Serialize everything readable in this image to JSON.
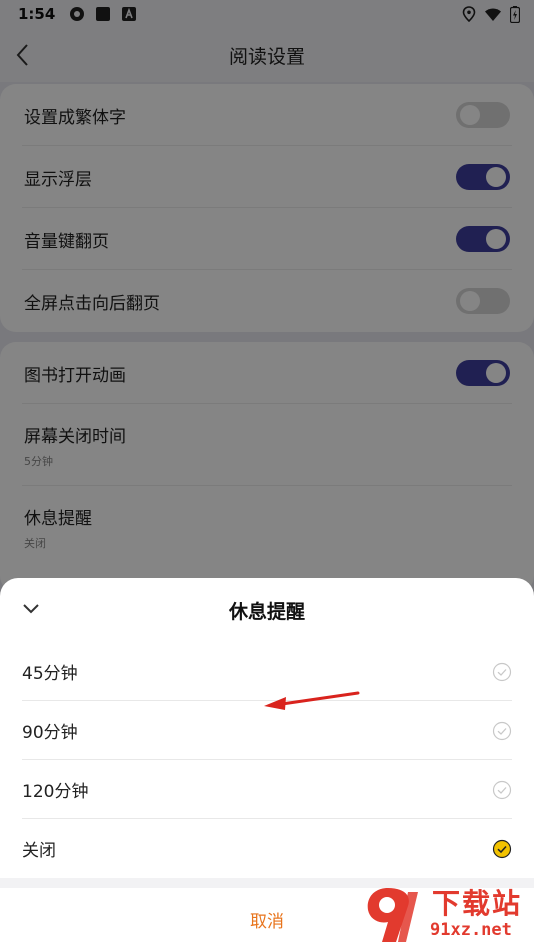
{
  "status_bar": {
    "time": "1:54"
  },
  "app_bar": {
    "title": "阅读设置"
  },
  "settings": {
    "group1": [
      {
        "label": "设置成繁体字",
        "on": false
      },
      {
        "label": "显示浮层",
        "on": true
      },
      {
        "label": "音量键翻页",
        "on": true
      },
      {
        "label": "全屏点击向后翻页",
        "on": false
      }
    ],
    "group2": {
      "book_open_animation": {
        "label": "图书打开动画",
        "on": true
      },
      "screen_off_time": {
        "label": "屏幕关闭时间",
        "value": "5分钟"
      },
      "rest_reminder": {
        "label": "休息提醒",
        "value": "关闭"
      }
    }
  },
  "sheet": {
    "title": "休息提醒",
    "options": [
      {
        "label": "45分钟",
        "selected": false
      },
      {
        "label": "90分钟",
        "selected": false
      },
      {
        "label": "120分钟",
        "selected": false
      },
      {
        "label": "关闭",
        "selected": true
      }
    ],
    "cancel_label": "取消"
  },
  "watermark": {
    "brand": "下载站",
    "domain": "91xz.net"
  },
  "colors": {
    "toggle_on": "#3f3f9e",
    "accent_cancel": "#e8741c",
    "selected_check": "#f2c200",
    "annotation_arrow": "#d9231d"
  }
}
